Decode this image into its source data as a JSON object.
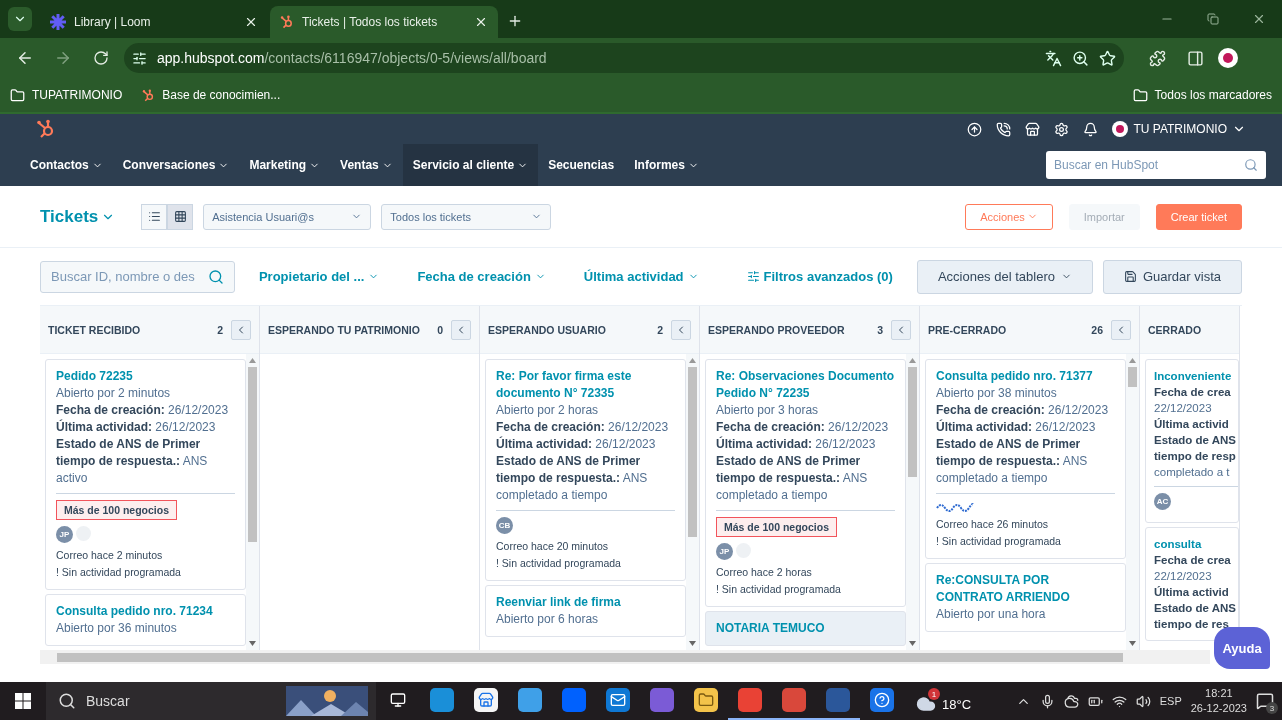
{
  "browser": {
    "tabs": [
      {
        "title": "Library | Loom",
        "selected": false,
        "kind": "loom"
      },
      {
        "title": "Tickets | Todos los tickets",
        "selected": true,
        "kind": "hubspot"
      }
    ],
    "url": {
      "host": "app.hubspot.com",
      "path": "/contacts/6116947/objects/0-5/views/all/board"
    },
    "bookmarks": [
      {
        "label": "TUPATRIMONIO",
        "kind": "folder"
      },
      {
        "label": "Base de conocimien...",
        "kind": "hubspot"
      }
    ],
    "all_bookmarks": "Todos los marcadores"
  },
  "hubspot": {
    "account": "TU PATRIMONIO",
    "nav": [
      {
        "label": "Contactos",
        "selected": false,
        "menu": true
      },
      {
        "label": "Conversaciones",
        "selected": false,
        "menu": true
      },
      {
        "label": "Marketing",
        "selected": false,
        "menu": true
      },
      {
        "label": "Ventas",
        "selected": false,
        "menu": true
      },
      {
        "label": "Servicio al cliente",
        "selected": true,
        "menu": true
      },
      {
        "label": "Secuencias",
        "selected": false,
        "menu": false
      },
      {
        "label": "Informes",
        "selected": false,
        "menu": true
      }
    ],
    "search_placeholder": "Buscar en HubSpot"
  },
  "header": {
    "title": "Tickets",
    "views": [
      {
        "kind": "list",
        "selected": false
      },
      {
        "kind": "board",
        "selected": true
      }
    ],
    "pipeline": "Asistencia Usuari@s",
    "view_filter": "Todos los tickets",
    "buttons": [
      {
        "label": "Acciones",
        "kind": "outline",
        "disabled": false
      },
      {
        "label": "Importar",
        "kind": "plain",
        "disabled": true
      },
      {
        "label": "Crear ticket",
        "kind": "primary",
        "disabled": false
      }
    ]
  },
  "filters": {
    "search_placeholder": "Buscar ID, nombre o des",
    "quick": [
      "Propietario del ...",
      "Fecha de creación",
      "Última actividad"
    ],
    "advanced": "Filtros avanzados (0)",
    "board_actions": "Acciones del tablero",
    "save_view": "Guardar vista"
  },
  "columns": [
    {
      "name": "TICKET RECIBIDO",
      "count": "2",
      "clipped": false,
      "cards": [
        {
          "title": "Pedido 72235",
          "open": "Abierto por 2 minutos",
          "highlighted": false,
          "fields": [
            "**Fecha de creación:** 26/12/2023",
            "**Última actividad:** 26/12/2023",
            "**Estado de ANS de Primer tiempo de respuesta.:** ANS activo"
          ],
          "tag": "Más de 100 negocios",
          "avatars": [
            {
              "kind": "initials",
              "text": "JP"
            },
            {
              "kind": "placeholder"
            }
          ],
          "activity": "Correo hace 2 minutos",
          "schedule": "! Sin actividad programada"
        },
        {
          "title": "Consulta pedido nro. 71234",
          "open": "Abierto por 36 minutos",
          "highlighted": false
        }
      ]
    },
    {
      "name": "ESPERANDO TU PATRIMONIO",
      "count": "0",
      "clipped": false
    },
    {
      "name": "ESPERANDO USUARIO",
      "count": "2",
      "clipped": false,
      "cards": [
        {
          "title": "Re: Por favor firma este documento N° 72335",
          "open": "Abierto por 2 horas",
          "highlighted": false,
          "fields": [
            "**Fecha de creación:** 26/12/2023",
            "**Última actividad:** 26/12/2023",
            "**Estado de ANS de Primer tiempo de respuesta.:** ANS completado a tiempo"
          ],
          "avatars": [
            {
              "kind": "initials",
              "text": "CB"
            }
          ],
          "activity": "Correo hace 20 minutos",
          "schedule": "! Sin actividad programada"
        },
        {
          "title": "Reenviar link de firma",
          "open": "Abierto por 6 horas",
          "highlighted": false
        }
      ]
    },
    {
      "name": "ESPERANDO PROVEEDOR",
      "count": "3",
      "clipped": false,
      "cards": [
        {
          "title": "Re: Observaciones Documento Pedido N° 72235",
          "open": "Abierto por 3 horas",
          "highlighted": false,
          "fields": [
            "**Fecha de creación:** 26/12/2023",
            "**Última actividad:** 26/12/2023",
            "**Estado de ANS de Primer tiempo de respuesta.:** ANS completado a tiempo"
          ],
          "tag": "Más de 100 negocios",
          "avatars": [
            {
              "kind": "initials",
              "text": "JP"
            },
            {
              "kind": "placeholder"
            }
          ],
          "activity": "Correo hace 2 horas",
          "schedule": "! Sin actividad programada"
        },
        {
          "title": "NOTARIA TEMUCO",
          "highlighted": true
        }
      ]
    },
    {
      "name": "PRE-CERRADO",
      "count": "26",
      "clipped": false,
      "cards": [
        {
          "title": "Consulta pedido nro. 71377",
          "open": "Abierto por 38 minutos",
          "highlighted": false,
          "fields": [
            "**Fecha de creación:** 26/12/2023",
            "**Última actividad:** 26/12/2023",
            "**Estado de ANS de Primer tiempo de respuesta.:** ANS completado a tiempo"
          ],
          "activity": "Correo hace 26 minutos",
          "schedule": "! Sin actividad programada"
        },
        {
          "title": "Re:CONSULTA POR CONTRATO ARRIENDO",
          "open": "Abierto por una hora",
          "highlighted": false
        }
      ]
    },
    {
      "name": "CERRADO",
      "clipped": true,
      "cards": [
        {
          "title": "Inconveniente",
          "highlighted": false,
          "fields": [
            "**Fecha de crea**",
            "22/12/2023",
            "**Última activid**",
            "**Estado de ANS**",
            "**tiempo de resp**",
            "completado a t"
          ],
          "avatars": [
            {
              "kind": "initials",
              "text": "AC"
            }
          ]
        },
        {
          "title": "consulta",
          "highlighted": false,
          "fields": [
            "**Fecha de crea**",
            "22/12/2023",
            "**Última activid**",
            "**Estado de ANS**",
            "**tiempo de res**"
          ]
        }
      ]
    }
  ],
  "help_button": "Ayuda",
  "taskbar": {
    "search": "Buscar",
    "apps": [
      {
        "kind": "taskview",
        "running": false
      },
      {
        "kind": "edge",
        "running": false
      },
      {
        "kind": "store",
        "running": false
      },
      {
        "kind": "mylife",
        "running": false
      },
      {
        "kind": "dropbox",
        "running": false
      },
      {
        "kind": "mail",
        "running": false
      },
      {
        "kind": "copilot",
        "running": false
      },
      {
        "kind": "folder",
        "running": false
      },
      {
        "kind": "chrome",
        "running": true
      },
      {
        "kind": "tool",
        "running": true
      },
      {
        "kind": "word",
        "running": true
      },
      {
        "kind": "help",
        "running": false
      }
    ],
    "weather": "18°C",
    "weather_badge": "1",
    "language": "ESP",
    "time": "18:21",
    "date": "26-12-2023",
    "notifications": "3"
  }
}
